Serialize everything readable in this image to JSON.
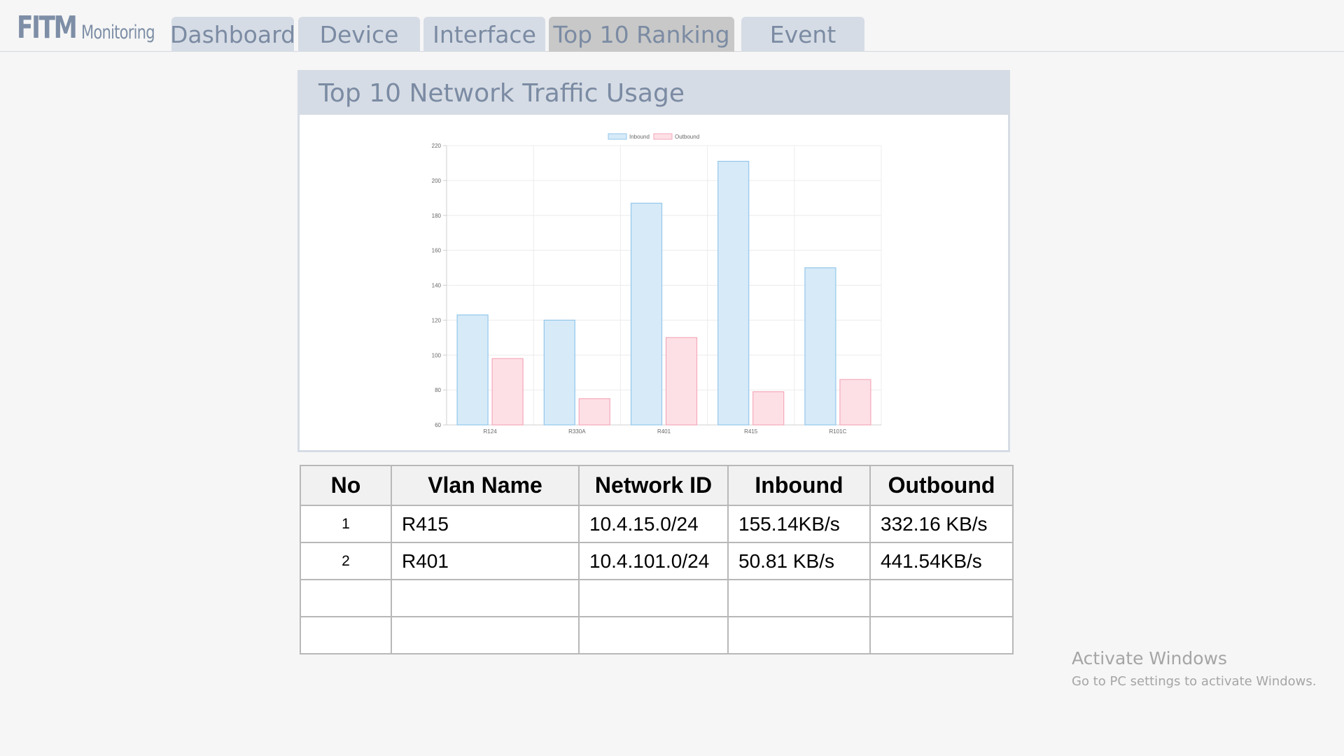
{
  "app": {
    "logo_main": "FITM",
    "logo_sub": "Monitoring"
  },
  "tabs": [
    {
      "label": "Dashboard",
      "active": false
    },
    {
      "label": "Device",
      "active": false
    },
    {
      "label": "Interface",
      "active": false
    },
    {
      "label": "Top 10 Ranking",
      "active": true
    },
    {
      "label": "Event",
      "active": false
    }
  ],
  "panel": {
    "title": "Top 10 Network Traffic Usage"
  },
  "chart_data": {
    "type": "bar",
    "categories": [
      "R124",
      "R330A",
      "R401",
      "R415",
      "R101C"
    ],
    "series": [
      {
        "name": "Inbound",
        "values": [
          123,
          120,
          187,
          211,
          150
        ],
        "fill": "#d6eaf8",
        "stroke": "#94c7eb"
      },
      {
        "name": "Outbound",
        "values": [
          98,
          75,
          110,
          79,
          86
        ],
        "fill": "#fde0e6",
        "stroke": "#f4a9bb"
      }
    ],
    "title": "",
    "xlabel": "",
    "ylabel": "",
    "ylim": [
      60,
      220
    ],
    "yticks": [
      60,
      80,
      100,
      120,
      140,
      160,
      180,
      200,
      220
    ],
    "grid": true,
    "legend": "top"
  },
  "table": {
    "headers": [
      "No",
      "Vlan Name",
      "Network ID",
      "Inbound",
      "Outbound"
    ],
    "rows": [
      [
        "1",
        "R415",
        "10.4.15.0/24",
        "155.14KB/s",
        "332.16 KB/s"
      ],
      [
        "2",
        "R401",
        "10.4.101.0/24",
        "50.81 KB/s",
        "441.54KB/s"
      ],
      [
        "",
        "",
        "",
        "",
        ""
      ],
      [
        "",
        "",
        "",
        "",
        ""
      ]
    ]
  },
  "watermark": {
    "line1": "Activate Windows",
    "line2": "Go to PC settings to activate Windows."
  }
}
